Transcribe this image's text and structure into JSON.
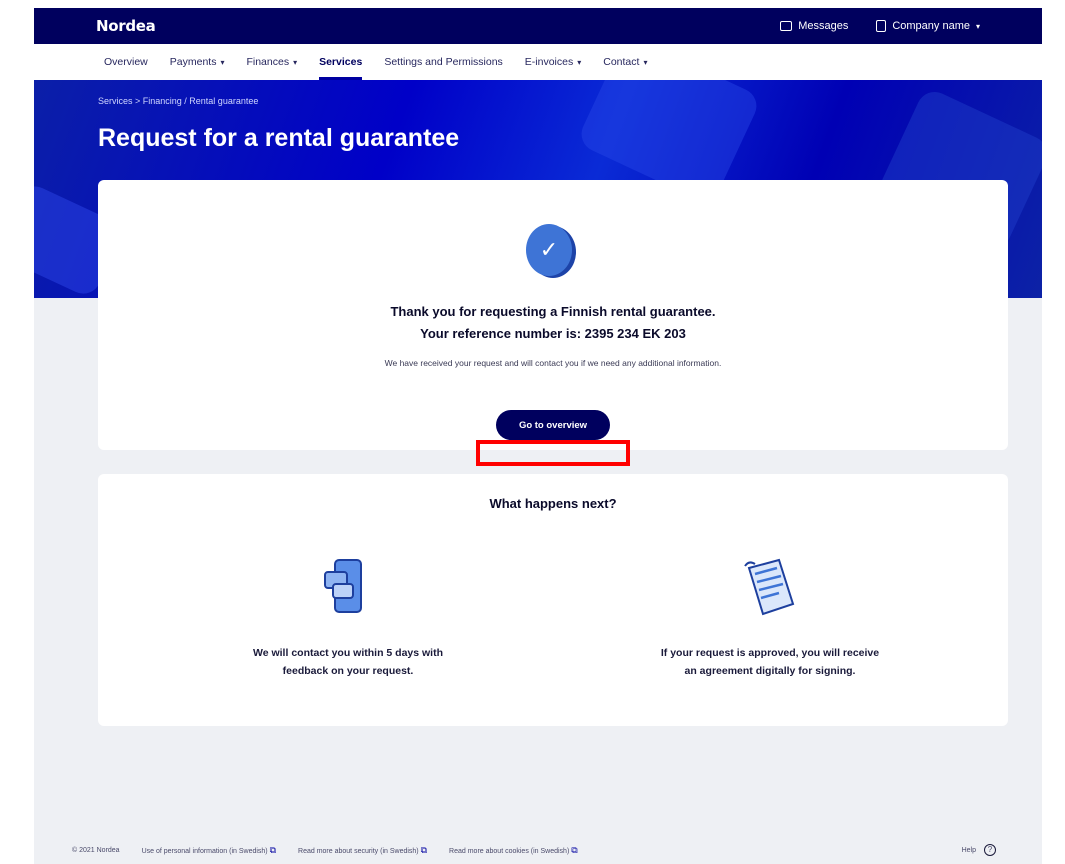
{
  "header": {
    "logo": "Nordea",
    "messages_label": "Messages",
    "company_label": "Company name"
  },
  "nav": {
    "items": [
      {
        "label": "Overview",
        "has_menu": false,
        "active": false
      },
      {
        "label": "Payments",
        "has_menu": true,
        "active": false
      },
      {
        "label": "Finances",
        "has_menu": true,
        "active": false
      },
      {
        "label": "Services",
        "has_menu": false,
        "active": true
      },
      {
        "label": "Settings and Permissions",
        "has_menu": false,
        "active": false
      },
      {
        "label": "E-invoices",
        "has_menu": true,
        "active": false
      },
      {
        "label": "Contact",
        "has_menu": true,
        "active": false
      }
    ]
  },
  "breadcrumb": "Services  >  Financing  /  Rental guarantee",
  "page_title": "Request for a rental guarantee",
  "confirmation": {
    "thanks": "Thank you for requesting a Finnish rental guarantee.",
    "reference": "Your reference number is: 2395 234 EK 203",
    "note": "We have received your request and will contact you if we need any additional information.",
    "button_label": "Go to overview"
  },
  "next_steps": {
    "title": "What happens next?",
    "steps": [
      {
        "text_line1": "We will contact you within 5 days with",
        "text_line2": "feedback on your request."
      },
      {
        "text_line1": "If your request is approved, you will receive",
        "text_line2": "an agreement digitally for signing."
      }
    ]
  },
  "footer": {
    "copyright": "© 2021 Nordea",
    "link1": "Use of personal information (in Swedish)",
    "link2": "Read more about security (in Swedish)",
    "link3": "Read more about cookies (in Swedish)",
    "help": "Help"
  },
  "colors": {
    "brand_dark": "#00005e",
    "hero_blue": "#0000c8",
    "highlight": "#ff0000"
  }
}
